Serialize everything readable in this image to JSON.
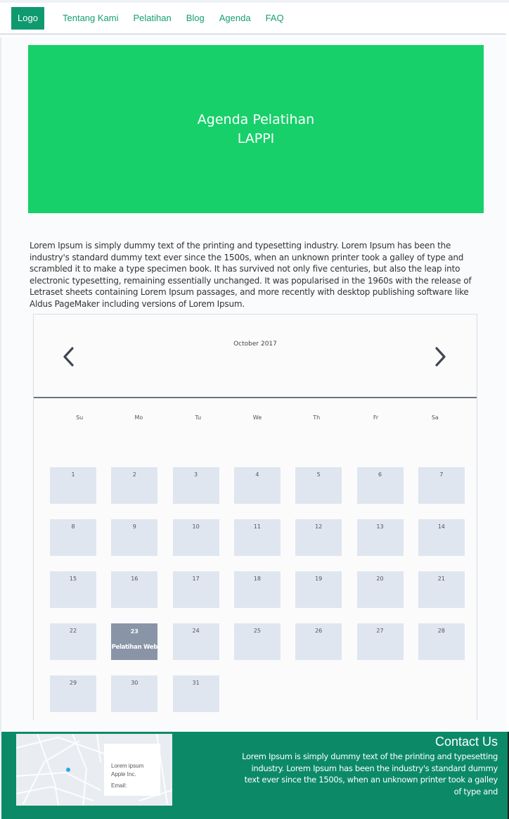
{
  "nav": {
    "logo": "Logo",
    "links": [
      "Tentang Kami",
      "Pelatihan",
      "Blog",
      "Agenda",
      "FAQ"
    ]
  },
  "hero": {
    "title_line1": "Agenda Pelatihan",
    "title_line2": "LAPPI"
  },
  "intro": "Lorem Ipsum is simply dummy text of the printing and typesetting industry. Lorem Ipsum has been the industry's standard dummy text ever since the 1500s, when an unknown printer took a galley of type and scrambled it to make a type specimen book. It has survived not only five centuries, but also the leap into electronic typesetting, remaining essentially unchanged. It was popularised in the 1960s with the release of Letraset sheets containing Lorem Ipsum passages, and more recently with desktop publishing software like Aldus PageMaker including versions of Lorem Ipsum.",
  "calendar": {
    "month": "October 2017",
    "weekdays": [
      "Su",
      "Mo",
      "Tu",
      "We",
      "Th",
      "Fr",
      "Sa"
    ],
    "days": [
      "1",
      "2",
      "3",
      "4",
      "5",
      "6",
      "7",
      "8",
      "9",
      "10",
      "11",
      "12",
      "13",
      "14",
      "15",
      "16",
      "17",
      "18",
      "19",
      "20",
      "21",
      "22",
      "23",
      "24",
      "25",
      "26",
      "27",
      "28",
      "29",
      "30",
      "31"
    ],
    "event_day": "23",
    "event_label": "Pelatihan Web"
  },
  "footer": {
    "map_card": [
      "Lorem ipsum",
      "Apple Inc.",
      "Email:"
    ],
    "contact_title": "Contact Us",
    "contact_text": "Lorem Ipsum is simply dummy text of the printing and typesetting industry. Lorem Ipsum has been the industry's standard dummy text ever since the 1500s, when an unknown printer took a galley of type and"
  },
  "colors": {
    "brand": "#0e9a6e",
    "hero": "#17d06a",
    "nav_link": "#14a06e",
    "day_cell": "#dfe6ef",
    "active_day": "#8995a6",
    "footer": "#0c8a68"
  }
}
